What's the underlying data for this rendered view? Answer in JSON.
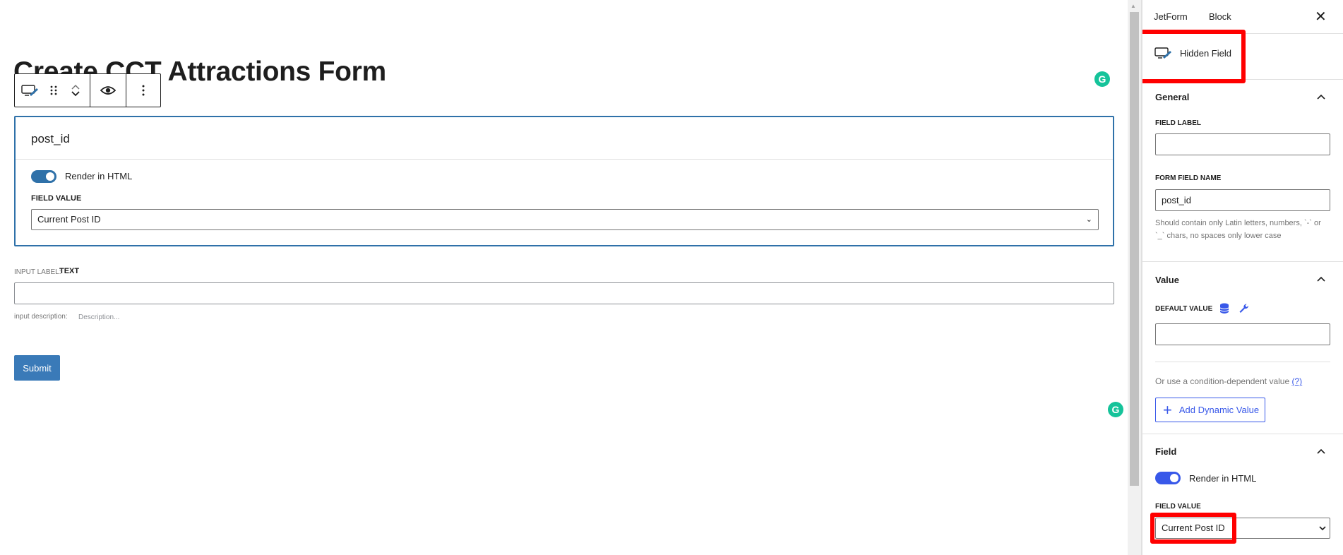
{
  "editor": {
    "page_title": "Create CCT Attractions Form",
    "hidden_block": {
      "name": "post_id",
      "render_label": "Render in HTML",
      "field_value_label": "FIELD VALUE",
      "field_value": "Current Post ID"
    },
    "text_field": {
      "label_prefix": "INPUT LABEL:",
      "label": "TEXT",
      "description_label": "input description:",
      "description_placeholder": "Description..."
    },
    "submit_label": "Submit"
  },
  "sidebar": {
    "tabs": [
      "JetForm",
      "Block"
    ],
    "close_icon": "close-icon",
    "block_card_title": "Hidden Field",
    "general": {
      "title": "General",
      "field_label_label": "FIELD LABEL",
      "field_label_value": "",
      "form_field_name_label": "FORM FIELD NAME",
      "form_field_name_value": "post_id",
      "help": "Should contain only Latin letters, numbers, `-` or `_` chars, no spaces only lower case"
    },
    "value": {
      "title": "Value",
      "default_value_label": "DEFAULT VALUE",
      "default_value": "",
      "condition_text": "Or use a condition-dependent value",
      "condition_link": "(?)",
      "add_dynamic_label": "Add Dynamic Value"
    },
    "field": {
      "title": "Field",
      "render_label": "Render in HTML",
      "field_value_label": "FIELD VALUE",
      "field_value": "Current Post ID"
    }
  },
  "colors": {
    "accent": "#3858e9",
    "block_border": "#2f71a9",
    "submit": "#3a7ab8",
    "highlight": "#ff0000",
    "grammarly": "#15c39a"
  }
}
